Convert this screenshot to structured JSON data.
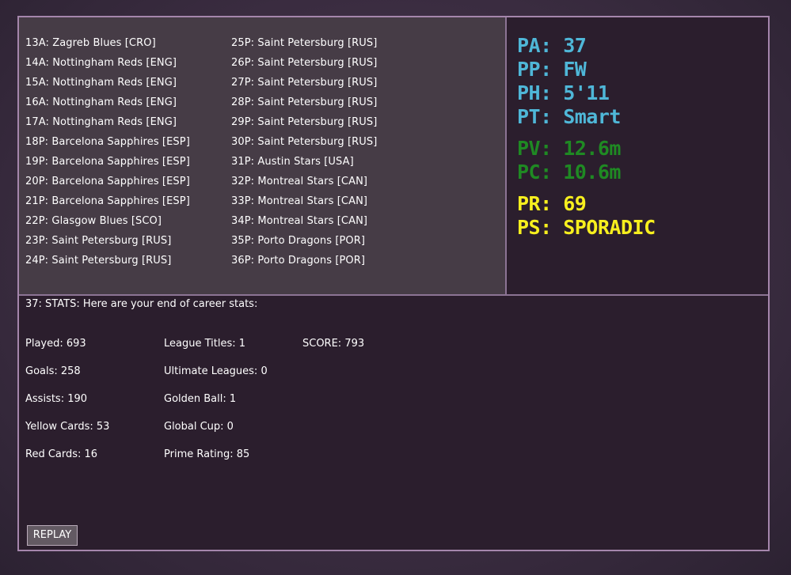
{
  "career": {
    "left_column": [
      "13A:  Zagreb Blues [CRO]",
      "14A:  Nottingham Reds [ENG]",
      "15A:  Nottingham Reds [ENG]",
      "16A:  Nottingham Reds [ENG]",
      "17A:  Nottingham Reds [ENG]",
      "18P:  Barcelona Sapphires [ESP]",
      "19P:  Barcelona Sapphires [ESP]",
      "20P:  Barcelona Sapphires [ESP]",
      "21P:  Barcelona Sapphires [ESP]",
      "22P:  Glasgow Blues [SCO]",
      "23P:  Saint Petersburg [RUS]",
      "24P:  Saint Petersburg [RUS]"
    ],
    "right_column": [
      "25P:  Saint Petersburg [RUS]",
      "26P:  Saint Petersburg [RUS]",
      "27P:  Saint Petersburg [RUS]",
      "28P:  Saint Petersburg [RUS]",
      "29P:  Saint Petersburg [RUS]",
      "30P:  Saint Petersburg [RUS]",
      "31P:  Austin Stars [USA]",
      "32P:  Montreal Stars [CAN]",
      "33P:  Montreal Stars [CAN]",
      "34P:  Montreal Stars [CAN]",
      "35P:  Porto Dragons [POR]",
      "36P:  Porto Dragons [POR]"
    ]
  },
  "attributes": {
    "pa": "PA: 37",
    "pp": "PP: FW",
    "ph": "PH: 5'11",
    "pt": "PT: Smart",
    "pv": "PV: 12.6m",
    "pc": "PC: 10.6m",
    "pr": "PR: 69",
    "ps": "PS: SPORADIC"
  },
  "stats": {
    "header": "37: STATS: Here are your end of career stats:",
    "played": "Played: 693",
    "goals": "Goals: 258",
    "assists": "Assists: 190",
    "yellow_cards": "Yellow Cards: 53",
    "red_cards": "Red Cards: 16",
    "league_titles": "League Titles: 1",
    "ultimate_leagues": "Ultimate Leagues: 0",
    "golden_ball": "Golden Ball: 1",
    "global_cup": "Global Cup: 0",
    "prime_rating": "Prime Rating: 85",
    "score": "SCORE: 793"
  },
  "replay_label": "REPLAY",
  "colors": {
    "blue": "#4fb7d8",
    "green": "#1f8a23",
    "yellow": "#f7ef1e"
  }
}
